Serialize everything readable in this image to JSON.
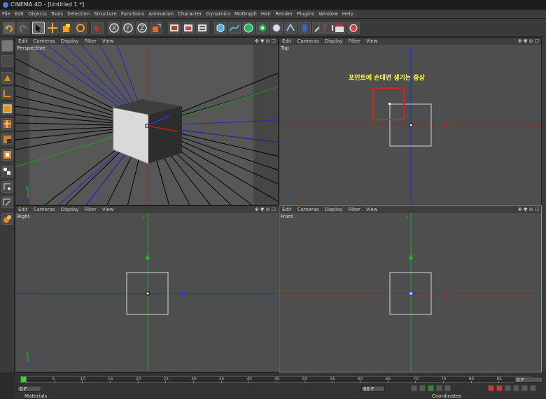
{
  "window": {
    "title": "CINEMA 4D - [Untitled 1 *]"
  },
  "menu": [
    "File",
    "Edit",
    "Objects",
    "Tools",
    "Selection",
    "Structure",
    "Functions",
    "Animation",
    "Character",
    "Dynamics",
    "MoGraph",
    "Hair",
    "Render",
    "Plugins",
    "Window",
    "Help"
  ],
  "viewport_menu": [
    "Edit",
    "Cameras",
    "Display",
    "Filter",
    "View"
  ],
  "viewports": {
    "perspective": {
      "name": "Perspective"
    },
    "top": {
      "name": "Top"
    },
    "right": {
      "name": "Right"
    },
    "front": {
      "name": "Front"
    }
  },
  "viewport_icons": "✥ ▼ ⊘ ☐",
  "axis_labels": {
    "x": "x",
    "y": "y",
    "z": "z",
    "X": "X",
    "Y": "Y",
    "Z": "Z"
  },
  "annotation": "포인트에 손대면 생기는 증상",
  "timeline": {
    "ticks": [
      "0",
      "5",
      "10",
      "15",
      "20",
      "25",
      "30",
      "35",
      "40",
      "45",
      "50",
      "55",
      "60",
      "65",
      "70",
      "75",
      "80",
      "85",
      "90"
    ],
    "start_field": "0 F",
    "end_field": "90 F",
    "current_field": "0 F"
  },
  "bottom_tabs": {
    "materials": "Materials",
    "coordinates": "Coordinates"
  },
  "colors": {
    "accent_red": "#e02020",
    "annotation": "#ffff33",
    "x_axis": "#c02020",
    "y_axis": "#20c020",
    "z_axis": "#2040e0"
  }
}
